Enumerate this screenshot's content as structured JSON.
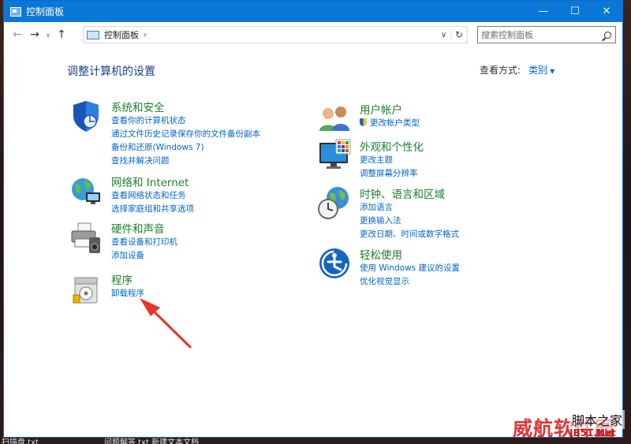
{
  "desktop": {
    "frag_left_label": "扫描盘.txt",
    "frag_mid_label": "问题解答.txt  新建文本文档"
  },
  "window": {
    "title": "控制面板",
    "controls": {
      "minimize": "—",
      "maximize": "☐",
      "close": "✕"
    }
  },
  "nav": {
    "back": "←",
    "forward": "→",
    "recent": "∨",
    "up": "↑",
    "address": "控制面板",
    "address_sep": "›",
    "dropdown": "∨",
    "refresh": "↻",
    "search_placeholder": "搜索控制面板"
  },
  "main": {
    "heading": "调整计算机的设置",
    "view_by_label": "查看方式:",
    "view_by_value": "类别",
    "view_by_caret": "▼"
  },
  "categories": [
    {
      "title": "系统和安全",
      "links": [
        "查看你的计算机状态",
        "通过文件历史记录保存你的文件备份副本",
        "备份和还原(Windows 7)",
        "查找并解决问题"
      ]
    },
    {
      "title": "网络和 Internet",
      "links": [
        "查看网络状态和任务",
        "选择家庭组和共享选项"
      ]
    },
    {
      "title": "硬件和声音",
      "links": [
        "查看设备和打印机",
        "添加设备"
      ]
    },
    {
      "title": "程序",
      "links": [
        "卸载程序"
      ]
    },
    {
      "title": "用户帐户",
      "links": [
        "更改帐户类型"
      ]
    },
    {
      "title": "外观和个性化",
      "links": [
        "更改主题",
        "调整屏幕分辨率"
      ]
    },
    {
      "title": "时钟、语言和区域",
      "links": [
        "添加语言",
        "更换输入法",
        "更改日期、时间或数字格式"
      ]
    },
    {
      "title": "轻松使用",
      "links": [
        "使用 Windows 建议的设置",
        "优化视觉显示"
      ]
    }
  ],
  "watermark": {
    "main": "威航软件园",
    "sub": "脚本之家",
    "site": "JB51.Net"
  },
  "colors": {
    "titlebar": "#0a78d7",
    "heading": "#1c3f8f",
    "category_title": "#1e7e2f",
    "link": "#0066cc",
    "annotation_arrow": "#e8322b"
  }
}
